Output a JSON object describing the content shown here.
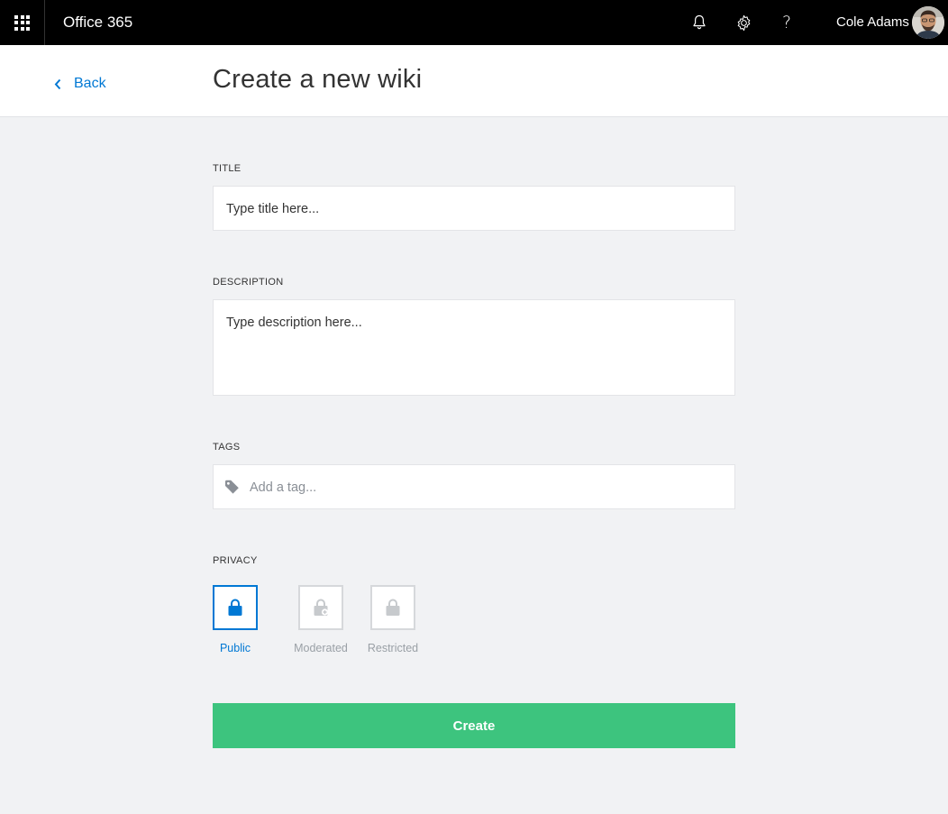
{
  "topbar": {
    "app_name": "Office 365",
    "user_name": "Cole Adams",
    "help_glyph": "?",
    "icons": [
      "app-launcher-icon",
      "bell-icon",
      "gear-icon",
      "help-icon"
    ]
  },
  "header": {
    "back_label": "Back",
    "title": "Create a new wiki"
  },
  "form": {
    "title_label": "TITLE",
    "title_placeholder": "Type title here...",
    "description_label": "DESCRIPTION",
    "description_placeholder": "Type description here...",
    "tags_label": "TAGS",
    "tags_placeholder": "Add a tag...",
    "privacy_label": "PRIVACY",
    "privacy_options": [
      {
        "label": "Public",
        "selected": true
      },
      {
        "label": "Moderated",
        "selected": false
      },
      {
        "label": "Restricted",
        "selected": false
      }
    ],
    "create_label": "Create"
  },
  "colors": {
    "accent": "#0078d4",
    "create_button": "#3dc47e",
    "topbar": "#000000"
  }
}
